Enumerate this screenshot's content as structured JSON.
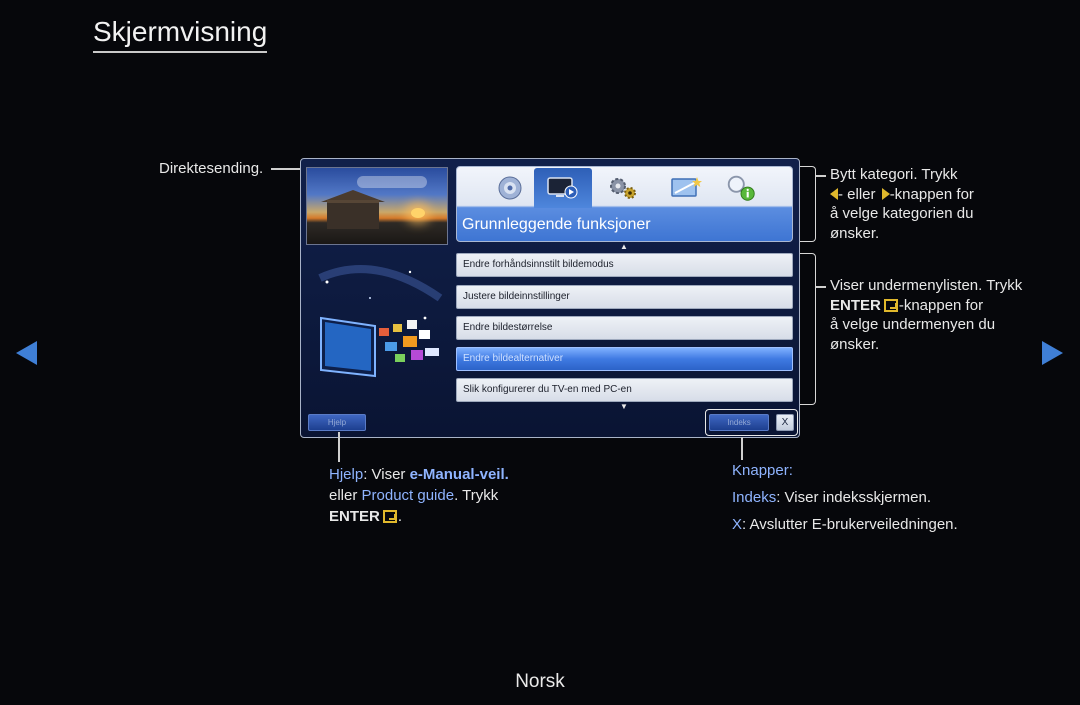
{
  "page": {
    "title": "Skjermvisning",
    "footer_language": "Norsk"
  },
  "callouts": {
    "live_tv": "Direktesending.",
    "category": {
      "line1": "Bytt kategori. Trykk",
      "line2_or": "- eller ",
      "line2_rest": "-knappen for",
      "line3": "å velge kategorien du",
      "line4": "ønsker."
    },
    "submenu": {
      "line1": "Viser undermenylisten. Trykk",
      "line2_enter": "ENTER",
      "line2_rest": "-knappen for",
      "line3": "å velge undermenyen du",
      "line4": "ønsker."
    },
    "help": {
      "label": "Hjelp",
      "sep": ": Viser ",
      "emanual": "e-Manual-veil.",
      "or": "eller ",
      "product_guide": "Product guide",
      "press": ". Trykk",
      "enter": "ENTER",
      "end": "."
    },
    "buttons": {
      "heading": "Knapper:",
      "index_label": "Indeks",
      "index_text": ": Viser indeksskjermen.",
      "x_label": "X",
      "x_text": ": Avslutter E-brukerveiledningen."
    }
  },
  "menu": {
    "category_title": "Grunnleggende funksjoner",
    "categories": [
      {
        "icon": "disc-icon",
        "selected": false
      },
      {
        "icon": "tv-play-icon",
        "selected": true
      },
      {
        "icon": "gears-icon",
        "selected": false
      },
      {
        "icon": "tv-star-icon",
        "selected": false
      },
      {
        "icon": "search-info-icon",
        "selected": false
      }
    ],
    "items": [
      {
        "label": "Endre forhåndsinnstilt bildemodus"
      },
      {
        "label": "Justere bildeinnstillinger"
      },
      {
        "label": "Endre bildestørrelse"
      },
      {
        "label": "Endre bildealternativer"
      },
      {
        "label": "Slik konfigurerer du TV-en med PC-en"
      }
    ],
    "help_button": "Hjelp",
    "index_button": "Indeks",
    "close_button": "X"
  },
  "colors": {
    "highlight": "#8fb4ff",
    "enter_icon": "#e0b82c",
    "nav_arrow": "#3f7fd6"
  }
}
